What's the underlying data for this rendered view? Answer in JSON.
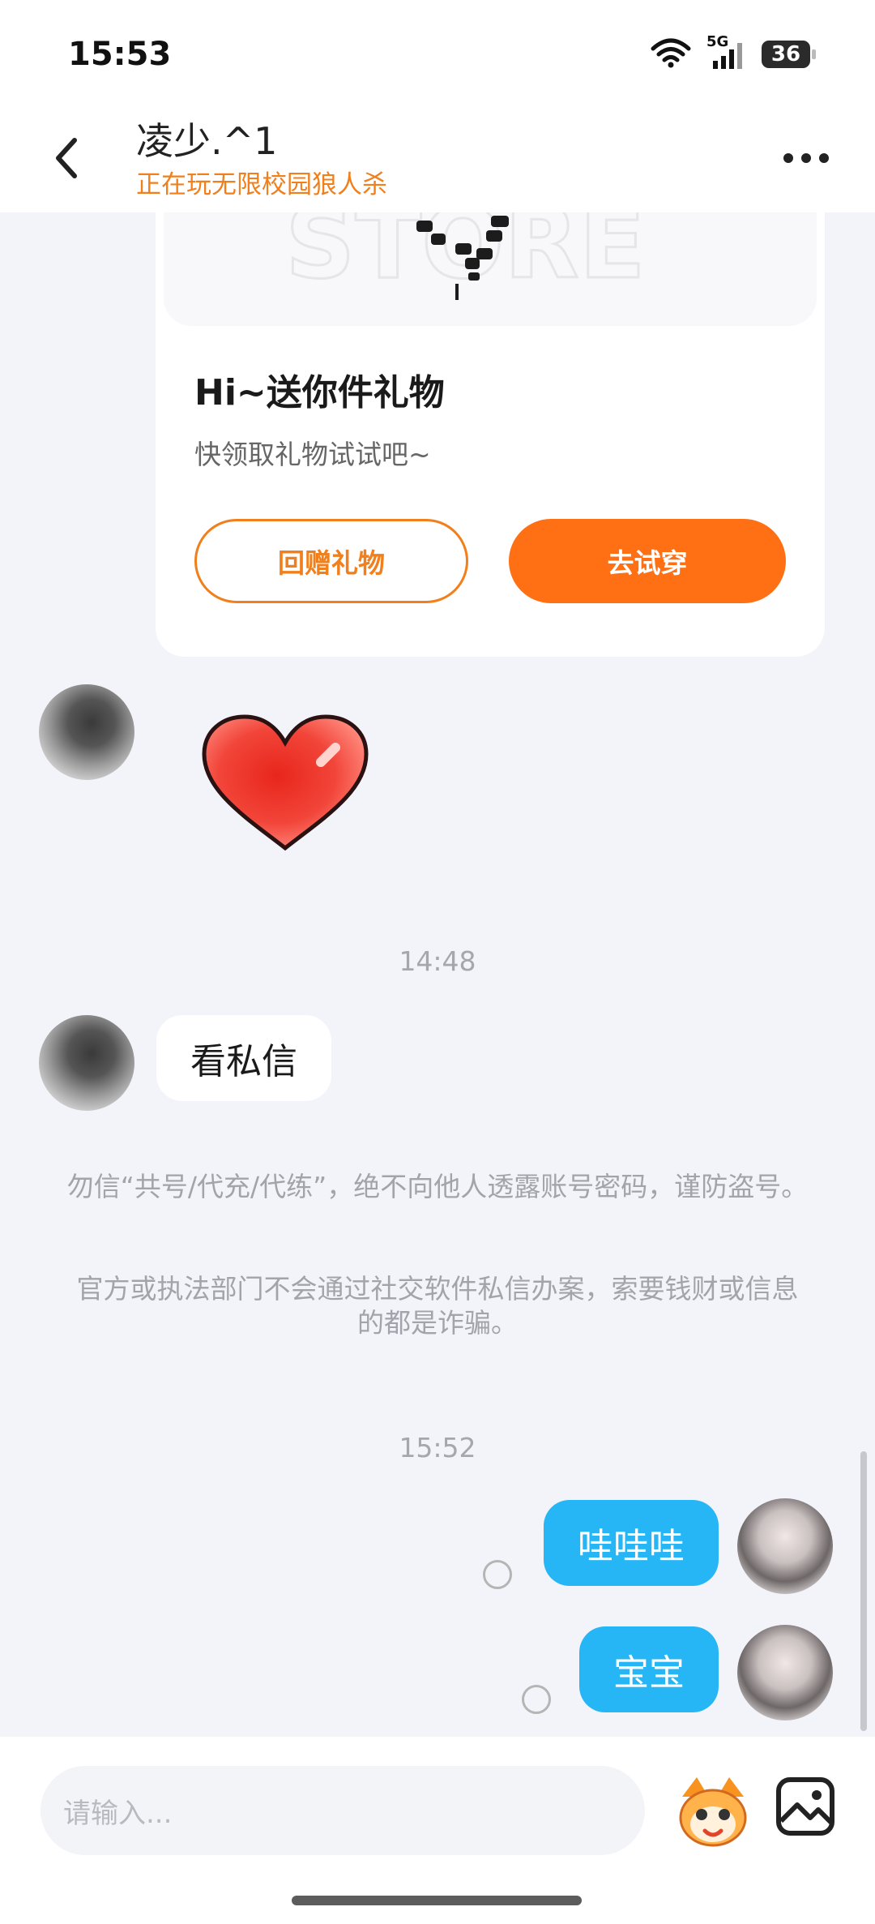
{
  "status_bar": {
    "time": "15:53",
    "network": "5G",
    "battery": "36"
  },
  "header": {
    "title": "凌少.^1",
    "subtitle": "正在玩无限校园狼人杀"
  },
  "gift_card": {
    "title": "Hi~送你件礼物",
    "description": "快领取礼物试试吧~",
    "return_gift_label": "回赠礼物",
    "try_on_label": "去试穿"
  },
  "messages": {
    "time_1": "14:48",
    "incoming_text": "看私信",
    "notice_1": "勿信“共号/代充/代练”，绝不向他人透露账号密码，谨防盗号。",
    "notice_2": "官方或执法部门不会通过社交软件私信办案，索要钱财或信息的都是诈骗。",
    "time_2": "15:52",
    "outgoing_1": "哇哇哇",
    "outgoing_2": "宝宝"
  },
  "input": {
    "placeholder": "请输入..."
  },
  "colors": {
    "accent_orange": "#fe7013",
    "subtitle_orange": "#f07f1c",
    "bubble_blue": "#27b6f5"
  },
  "icons": [
    "back-icon",
    "more-icon",
    "wifi-icon",
    "signal-icon",
    "battery-icon",
    "heart-sticker-icon",
    "emoji-icon",
    "image-icon"
  ]
}
